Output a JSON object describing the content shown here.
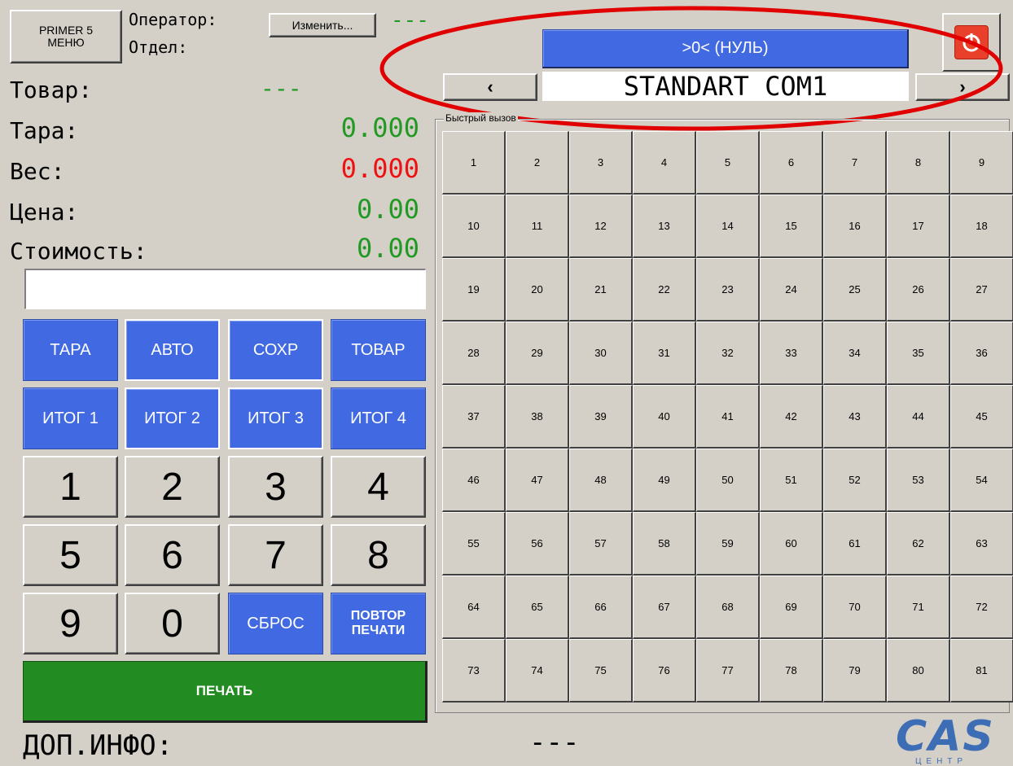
{
  "menu_button": {
    "line1": "PRIMER 5",
    "line2": "МЕНЮ"
  },
  "operator": {
    "label": "Оператор:",
    "change_button": "Изменить...",
    "value": "---"
  },
  "department": {
    "label": "Отдел:"
  },
  "product": {
    "label": "Товар:",
    "value": "---"
  },
  "readouts": {
    "tare": {
      "label": "Тара:",
      "value": "0.000",
      "color": "#229922"
    },
    "weight": {
      "label": "Вес:",
      "value": "0.000",
      "color": "#ee1111"
    },
    "price": {
      "label": "Цена:",
      "value": "0.00",
      "color": "#229922"
    },
    "cost": {
      "label": "Стоимость:",
      "value": "0.00",
      "color": "#229922"
    }
  },
  "input_value": "",
  "function_buttons": {
    "tare": "ТАРА",
    "auto": "АВТО",
    "save": "СОХР",
    "product": "ТОВАР",
    "total1": "ИТОГ 1",
    "total2": "ИТОГ 2",
    "total3": "ИТОГ 3",
    "total4": "ИТОГ 4",
    "reset": "СБРОС",
    "reprint_line1": "ПОВТОР",
    "reprint_line2": "ПЕЧАТИ",
    "print": "ПЕЧАТЬ"
  },
  "keypad": [
    "1",
    "2",
    "3",
    "4",
    "5",
    "6",
    "7",
    "8",
    "9",
    "0"
  ],
  "zero_button": ">0< (НУЛЬ)",
  "scale_selector": {
    "prev": "‹",
    "name": "STANDART COM1",
    "next": "›"
  },
  "quick_call": {
    "title": "Быстрый вызов",
    "keys": [
      "1",
      "2",
      "3",
      "4",
      "5",
      "6",
      "7",
      "8",
      "9",
      "10",
      "11",
      "12",
      "13",
      "14",
      "15",
      "16",
      "17",
      "18",
      "19",
      "20",
      "21",
      "22",
      "23",
      "24",
      "25",
      "26",
      "27",
      "28",
      "29",
      "30",
      "31",
      "32",
      "33",
      "34",
      "35",
      "36",
      "37",
      "38",
      "39",
      "40",
      "41",
      "42",
      "43",
      "44",
      "45",
      "46",
      "47",
      "48",
      "49",
      "50",
      "51",
      "52",
      "53",
      "54",
      "55",
      "56",
      "57",
      "58",
      "59",
      "60",
      "61",
      "62",
      "63",
      "64",
      "65",
      "66",
      "67",
      "68",
      "69",
      "70",
      "71",
      "72",
      "73",
      "74",
      "75",
      "76",
      "77",
      "78",
      "79",
      "80",
      "81"
    ]
  },
  "extra_info": {
    "label": "ДОП.ИНФО:",
    "value": "---"
  },
  "logo": {
    "text": "CAS",
    "subtext": "ЦЕНТР"
  },
  "accent_colors": {
    "blue": "#4169e1",
    "green": "#228b22",
    "annotation_red": "#e00000",
    "power_red": "#e8402a"
  }
}
